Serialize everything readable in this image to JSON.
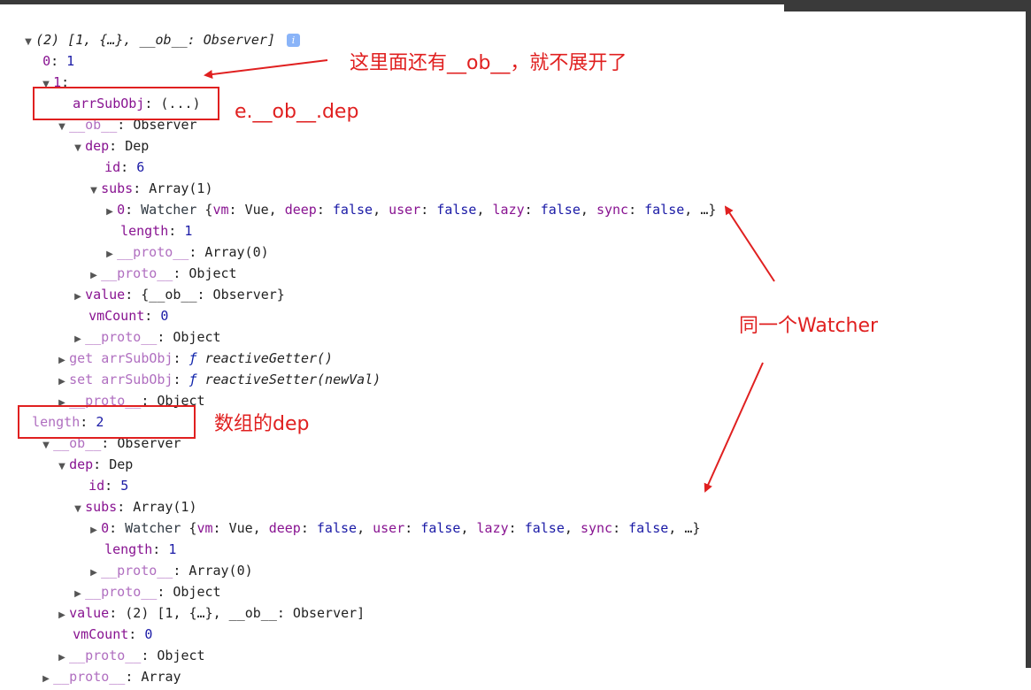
{
  "tree": {
    "root": {
      "label": "(2)",
      "preview": "[1, {…}, __ob__: Observer]",
      "info": "i"
    },
    "idx0": {
      "key": "0",
      "value": "1"
    },
    "idx1": {
      "key": "1"
    },
    "arrSubObj": {
      "key": "arrSubObj",
      "value": "(...)"
    },
    "ob1": {
      "key": "__ob__",
      "value": "Observer"
    },
    "dep1": {
      "key": "dep",
      "value": "Dep"
    },
    "id1": {
      "key": "id",
      "value": "6"
    },
    "subs1": {
      "key": "subs",
      "value": "Array(1)"
    },
    "watcher1": {
      "key": "0",
      "cls": "Watcher",
      "vm_key": "vm",
      "vm_val": "Vue",
      "deep_key": "deep",
      "deep_val": "false",
      "user_key": "user",
      "user_val": "false",
      "lazy_key": "lazy",
      "lazy_val": "false",
      "sync_key": "sync",
      "sync_val": "false",
      "more": "…"
    },
    "len1": {
      "key": "length",
      "value": "1"
    },
    "proto_arr1": {
      "key": "__proto__",
      "value": "Array(0)"
    },
    "proto_obj1": {
      "key": "__proto__",
      "value": "Object"
    },
    "value1": {
      "key": "value",
      "preview": "{__ob__: Observer}"
    },
    "vmcount1": {
      "key": "vmCount",
      "value": "0"
    },
    "proto_obj1b": {
      "key": "__proto__",
      "value": "Object"
    },
    "getter": {
      "prefix": "get",
      "key": "arrSubObj",
      "f": "ƒ",
      "fn": "reactiveGetter()"
    },
    "setter": {
      "prefix": "set",
      "key": "arrSubObj",
      "f": "ƒ",
      "fn": "reactiveSetter(newVal)"
    },
    "proto_obj1c": {
      "key": "__proto__",
      "value": "Object"
    },
    "length2": {
      "key": "length",
      "value": "2"
    },
    "ob2": {
      "key": "__ob__",
      "value": "Observer"
    },
    "dep2": {
      "key": "dep",
      "value": "Dep"
    },
    "id2": {
      "key": "id",
      "value": "5"
    },
    "subs2": {
      "key": "subs",
      "value": "Array(1)"
    },
    "watcher2": {
      "key": "0",
      "cls": "Watcher",
      "vm_key": "vm",
      "vm_val": "Vue",
      "deep_key": "deep",
      "deep_val": "false",
      "user_key": "user",
      "user_val": "false",
      "lazy_key": "lazy",
      "lazy_val": "false",
      "sync_key": "sync",
      "sync_val": "false",
      "more": "…"
    },
    "len2": {
      "key": "length",
      "value": "1"
    },
    "proto_arr2": {
      "key": "__proto__",
      "value": "Array(0)"
    },
    "proto_obj2": {
      "key": "__proto__",
      "value": "Object"
    },
    "value2": {
      "key": "value",
      "count": "(2)",
      "preview": "[1, {…}, __ob__: Observer]"
    },
    "vmcount2": {
      "key": "vmCount",
      "value": "0"
    },
    "proto_obj2b": {
      "key": "__proto__",
      "value": "Object"
    },
    "proto_array": {
      "key": "__proto__",
      "value": "Array"
    }
  },
  "annotations": {
    "inner_ob": "这里面还有__ob__，就不展开了",
    "e_ob_dep": "e.__ob__.dep",
    "same_watcher": "同一个Watcher",
    "array_dep": "数组的dep"
  },
  "colors": {
    "annotation": "#e02020",
    "key": "#881391",
    "value": "#1a1aa6"
  }
}
